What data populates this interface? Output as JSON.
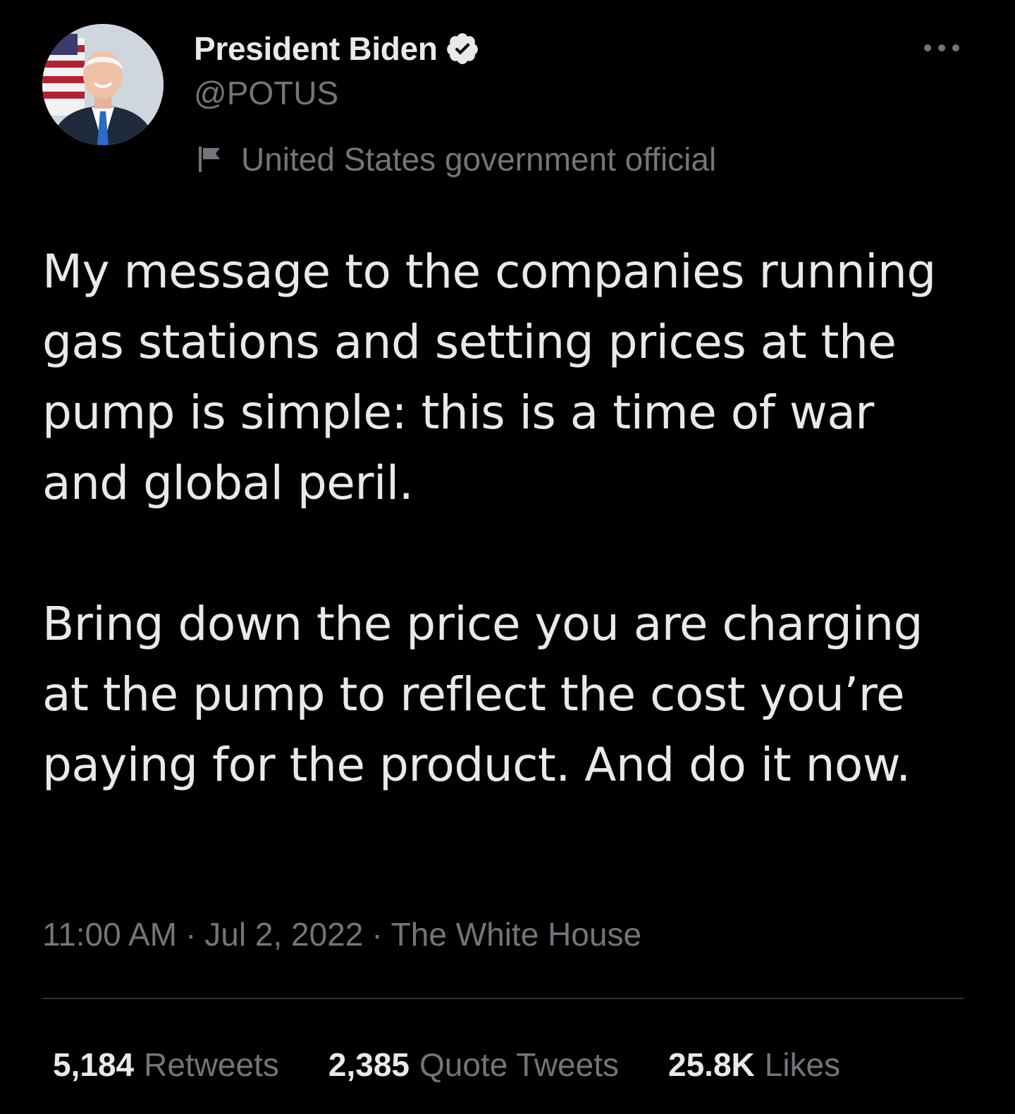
{
  "author": {
    "display_name": "President Biden",
    "handle": "@POTUS",
    "label": "United States government official",
    "verified": true
  },
  "icons": {
    "avatar": "avatar-photo",
    "verified": "verified-badge-icon",
    "flag": "flag-icon",
    "more": "more-options-icon"
  },
  "tweet": {
    "paragraphs": [
      "My message to the companies running gas stations and setting prices at the pump is simple: this is a time of war and global peril.",
      "Bring down the price you are charging at the pump to reflect the cost you’re paying for the product. And do it now."
    ],
    "time": "11:00 AM",
    "date": "Jul 2, 2022",
    "source": "The White House",
    "separator": "·"
  },
  "stats": {
    "retweets_count": "5,184",
    "retweets_label": "Retweets",
    "quotes_count": "2,385",
    "quotes_label": "Quote Tweets",
    "likes_count": "25.8K",
    "likes_label": "Likes"
  },
  "colors": {
    "background": "#000000",
    "primary_text": "#e7e9ea",
    "secondary_text": "#71767b",
    "divider": "#2f3336"
  }
}
